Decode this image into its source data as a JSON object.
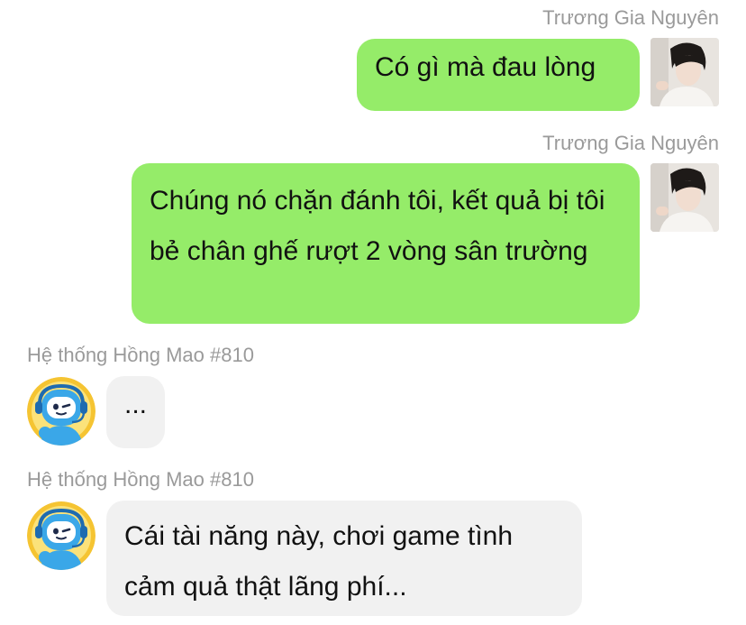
{
  "messages": [
    {
      "sender": "Trương Gia Nguyên",
      "text": "Có gì mà đau lòng",
      "side": "right",
      "avatar_icon": "user-avatar-photo"
    },
    {
      "sender": "Trương Gia Nguyên",
      "text": "Chúng nó chặn đánh tôi, kết quả bị tôi bẻ chân ghế rượt 2 vòng sân trường",
      "side": "right",
      "avatar_icon": "user-avatar-photo"
    },
    {
      "sender": "Hệ thống Hồng Mao #810",
      "text": "...",
      "side": "left",
      "avatar_icon": "robot-headset-icon"
    },
    {
      "sender": "Hệ thống Hồng Mao #810",
      "text": "Cái tài năng này, chơi game tình cảm quả thật lãng phí...",
      "side": "left",
      "avatar_icon": "robot-headset-icon"
    }
  ],
  "colors": {
    "outgoing_bubble": "#95ec69",
    "incoming_bubble": "#f1f1f1",
    "sender_name": "#9a9a9a",
    "bot_avatar_ring": "#f5c432",
    "bot_avatar_body": "#3aa7e8"
  }
}
